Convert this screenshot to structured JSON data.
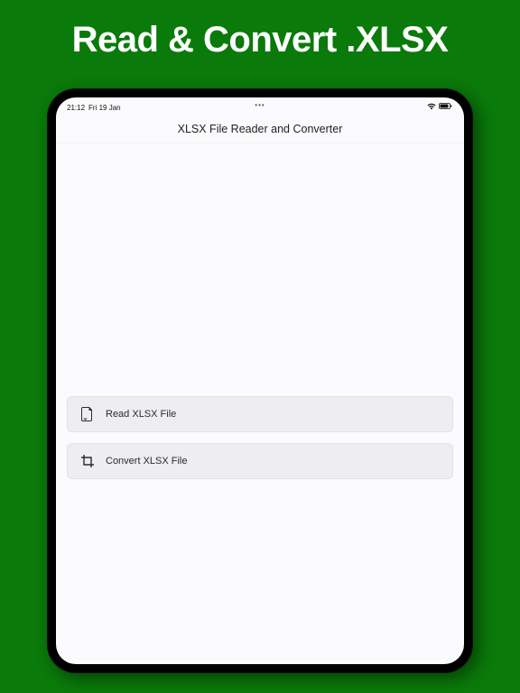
{
  "promo": {
    "title": "Read & Convert .XLSX"
  },
  "status_bar": {
    "time": "21:12",
    "date": "Fri 19 Jan",
    "center_dots": "•••"
  },
  "app": {
    "title": "XLSX File Reader and Converter"
  },
  "actions": {
    "read": {
      "label": "Read XLSX File"
    },
    "convert": {
      "label": "Convert XLSX File"
    }
  }
}
